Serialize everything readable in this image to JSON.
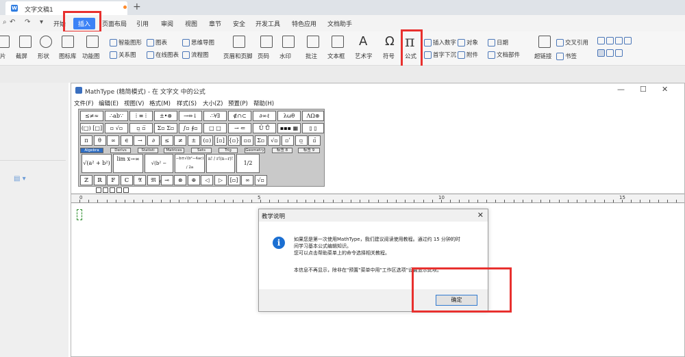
{
  "tab": {
    "title": "文字文稿1",
    "new_tab": "+"
  },
  "menubar": {
    "items": [
      "开始",
      "插入",
      "页面布局",
      "引用",
      "审阅",
      "视图",
      "章节",
      "安全",
      "开发工具",
      "特色应用",
      "文档助手"
    ],
    "quick_access": [
      "↶",
      "↷",
      "▾"
    ]
  },
  "ribbon": {
    "group1": [
      "智能图形",
      "图表",
      "思维导图",
      "关系图",
      "在线图表",
      "流程图"
    ],
    "left_labels": [
      "片",
      "截屏",
      "形状",
      "图标库",
      "功能图"
    ],
    "mid_labels": [
      "页眉和页脚",
      "页码",
      "水印",
      "批注",
      "文本框",
      "艺术字",
      "符号",
      "公式"
    ],
    "right_top": [
      "插入数字",
      "对象",
      "日期"
    ],
    "right_bottom": [
      "首字下沉",
      "附件",
      "文档部件"
    ],
    "far_right": [
      "超链接",
      "书签",
      "交叉引用"
    ]
  },
  "mathtype": {
    "title": "MathType (精简模式) - 在 文字文 中的公式",
    "menu": [
      "文件(F)",
      "编辑(E)",
      "视图(V)",
      "格式(M)",
      "样式(S)",
      "大小(Z)",
      "预置(P)",
      "帮助(H)"
    ],
    "palette_row1": [
      "≤≠≈",
      "∴ab∵",
      "⁞ ≡ ⁞",
      "±•⊗",
      "→⇔↓",
      "∴∀∃",
      "∉∩⊂",
      "∂∞ℓ",
      "λωθ",
      "ΛΩ⊛"
    ],
    "palette_row2": [
      "(□) [□]",
      "▫ √▫",
      "▫̲ ▫̅",
      "Σ▫ Σ▫",
      "∫▫ ∮▫",
      "□ □",
      "→ ⇐",
      "Û Ů",
      "▪▪▪ ▦",
      "▯ ▯"
    ],
    "palette_row3": [
      "π",
      "θ",
      "∞",
      "∈",
      "→",
      "∂",
      "≤",
      "≠",
      "±",
      "(▫)",
      "[▫]",
      "{▫}",
      "▫▫",
      "Σ▫",
      "√▫",
      "▫ʹ",
      "▫̲",
      "▫̄"
    ],
    "tabs": [
      "Algebra",
      "Derivs",
      "Statisti",
      "Matrices",
      "Sets",
      "Trig",
      "Geometry",
      "标签 8",
      "标签 9"
    ],
    "templates": [
      "√(a² + b²)",
      "lim x→∞",
      "√(b² − 4ac)",
      "−b±√(b²−4ac) / 2a",
      "n! / r!(n−r)!",
      "1/2"
    ],
    "palette_row5": [
      "ℤ",
      "ℝ",
      "𝔽",
      "ℂ",
      "𝔄",
      "𝔐",
      "⊸",
      "⊗",
      "⊕",
      "◁",
      "▷",
      "[▫]",
      "∞",
      "√▫"
    ],
    "ruler_marks": [
      "0",
      "5",
      "10",
      "15"
    ]
  },
  "dialog": {
    "title": "教学说明",
    "close": "✕",
    "lines": [
      "如果您是第一次使用MathType，我们建议阅读使用教程。通过约 15 分钟的时",
      "间学习基本公式编辑知识。",
      "您可以点击帮助菜单上的命令选择相关教程。",
      "本信息不再显示，除非在\"预置\"菜单中用\"工作区选项\"设置显示此项。"
    ],
    "ok_label": "确定"
  },
  "colors": {
    "accent": "#3b82f6",
    "highlight": "#e8302e",
    "info": "#1b6fd2"
  }
}
